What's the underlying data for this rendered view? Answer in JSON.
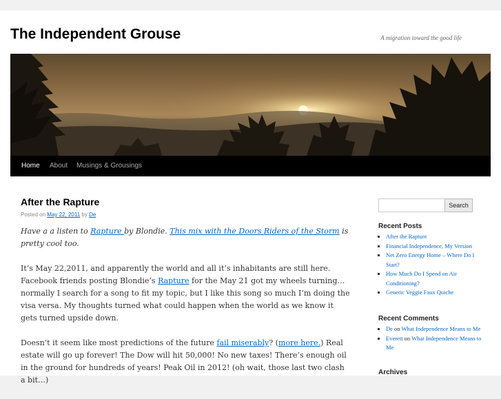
{
  "site": {
    "title": "The Independent Grouse",
    "description": "A migration toward the good life"
  },
  "nav": {
    "items": [
      {
        "label": "Home",
        "current": true
      },
      {
        "label": "About",
        "current": false
      },
      {
        "label": "Musings & Grousings",
        "current": false
      }
    ]
  },
  "post": {
    "title": "After the Rapture",
    "meta": {
      "posted_on": "Posted on",
      "date": "May 22, 2011",
      "by": "by",
      "author": "De"
    },
    "p1": {
      "t1": "Have a a listen to ",
      "link1": "Rapture ",
      "t2": "by Blondie.  ",
      "link2": "This mix with the Doors Riders of the Storm",
      "t3": " is pretty cool too."
    },
    "p2": {
      "t1": "It’s May 22,2011, and apparently the world and all it’s inhabitants are still here.  Facebook friends posting Blondie’s ",
      "link1": "Rapture",
      "t2": " for the May 21 got my wheels turning…  normally I search for a song to fit my topic, but I like this song so much I’m doing the visa versa.  My thoughts turned what could happen when the world as we know it gets turned upside down."
    },
    "p3": {
      "t1": "Doesn’t it seem like most predictions of the future ",
      "link1": "fail miserably",
      "t2": "?  (",
      "link2": "more here.",
      "t3": ")   Real estate will go up forever!  The Dow will hit 50,000!  No new taxes!  There’s enough oil in the ground for hundreds of years!  Peak Oil in 2012!  (oh wait, those last two clash a bit…)"
    }
  },
  "sidebar": {
    "search": {
      "placeholder": "",
      "value": "",
      "button_label": "Search"
    },
    "recent_posts": {
      "title": "Recent Posts",
      "items": [
        "After the Rapture",
        "Financial Independence, My Version",
        "Net Zero Energy Home – Where Do I Start?",
        "How Much Do I Spend on Air Conditioning?",
        "Generic Veggie Faux Quiche"
      ]
    },
    "recent_comments": {
      "title": "Recent Comments",
      "items": [
        {
          "author": "De",
          "on": "on",
          "post": "What Independence Means to Me"
        },
        {
          "author": "Everett",
          "on": "on",
          "post": "What Independence Means to Me"
        }
      ]
    },
    "archives": {
      "title": "Archives"
    }
  },
  "colors": {
    "link": "#0066cc",
    "nav_bg": "#000000",
    "page_bg": "#f1f1f1"
  }
}
